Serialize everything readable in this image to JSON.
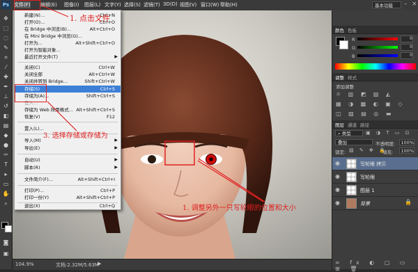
{
  "menubar": {
    "logo": "Ps",
    "items": [
      "文件(F)",
      "编辑(E)",
      "图像(I)",
      "图层(L)",
      "文字(Y)",
      "选择(S)",
      "滤镜(T)",
      "3D(D)",
      "视图(V)",
      "窗口(W)",
      "帮助(H)"
    ],
    "workspace": "基本功能"
  },
  "file_menu": {
    "rows": [
      {
        "label": "新建(N)...",
        "shortcut": "Ctrl+N"
      },
      {
        "label": "打开(O)...",
        "shortcut": "Ctrl+O"
      },
      {
        "label": "在 Bridge 中浏览(B)...",
        "shortcut": "Alt+Ctrl+O"
      },
      {
        "label": "在 Mini Bridge 中浏览(G)...",
        "shortcut": ""
      },
      {
        "label": "打开为...",
        "shortcut": "Alt+Shift+Ctrl+O"
      },
      {
        "label": "打开为智能对象...",
        "shortcut": ""
      },
      {
        "label": "最近打开文件(T)",
        "shortcut": ""
      },
      {
        "label": "关闭(C)",
        "shortcut": "Ctrl+W"
      },
      {
        "label": "关闭全部",
        "shortcut": "Alt+Ctrl+W"
      },
      {
        "label": "关闭并转到 Bridge...",
        "shortcut": "Shift+Ctrl+W"
      },
      {
        "label": "存储(S)",
        "shortcut": "Ctrl+S"
      },
      {
        "label": "存储为(A)...",
        "shortcut": "Shift+Ctrl+S"
      },
      {
        "label": "签入...",
        "shortcut": ""
      },
      {
        "label": "存储为 Web 所用格式...",
        "shortcut": "Alt+Shift+Ctrl+S"
      },
      {
        "label": "恢复(V)",
        "shortcut": "F12"
      },
      {
        "label": "置入(L)...",
        "shortcut": ""
      },
      {
        "label": "导入(M)",
        "shortcut": ""
      },
      {
        "label": "导出(E)",
        "shortcut": ""
      },
      {
        "label": "自动(U)",
        "shortcut": ""
      },
      {
        "label": "脚本(R)",
        "shortcut": ""
      },
      {
        "label": "文件简介(F)...",
        "shortcut": "Alt+Shift+Ctrl+I"
      },
      {
        "label": "打印(P)...",
        "shortcut": "Ctrl+P"
      },
      {
        "label": "打印一份(Y)",
        "shortcut": "Alt+Shift+Ctrl+P"
      },
      {
        "label": "退出(X)",
        "shortcut": "Ctrl+Q"
      }
    ]
  },
  "annotations": {
    "step1": "1. 点击文件",
    "step2": "3. 选择存储或存储为",
    "step3": "1. 调整另外一只写轮眼的位置和大小"
  },
  "status": {
    "zoom": "104.9%",
    "doc": "文档:2.32M/5.63M"
  },
  "color_panel": {
    "tabs": [
      "颜色",
      "色板"
    ],
    "rows": [
      {
        "label": "R",
        "value": "0"
      },
      {
        "label": "G",
        "value": "0"
      },
      {
        "label": "B",
        "value": "0"
      }
    ]
  },
  "adjust_panel": {
    "tabs": [
      "调整",
      "样式"
    ],
    "title": "添加调整"
  },
  "layers_panel": {
    "tabs": [
      "图层",
      "通道",
      "路径"
    ],
    "kind": "类型",
    "blend": "叠加",
    "opacity_label": "不透明度:",
    "opacity": "100%",
    "lock_label": "锁定:",
    "fill_label": "填充:",
    "fill": "100%",
    "layers": [
      {
        "name": "写轮眼 拷贝",
        "selected": true
      },
      {
        "name": "写轮眼",
        "selected": false
      },
      {
        "name": "图层 1",
        "selected": false
      },
      {
        "name": "背景",
        "selected": false
      }
    ]
  },
  "colors": {
    "annotation": "#e02020",
    "menu_highlight": "#3d7fd6",
    "layer_selected": "#5a6f8f"
  }
}
